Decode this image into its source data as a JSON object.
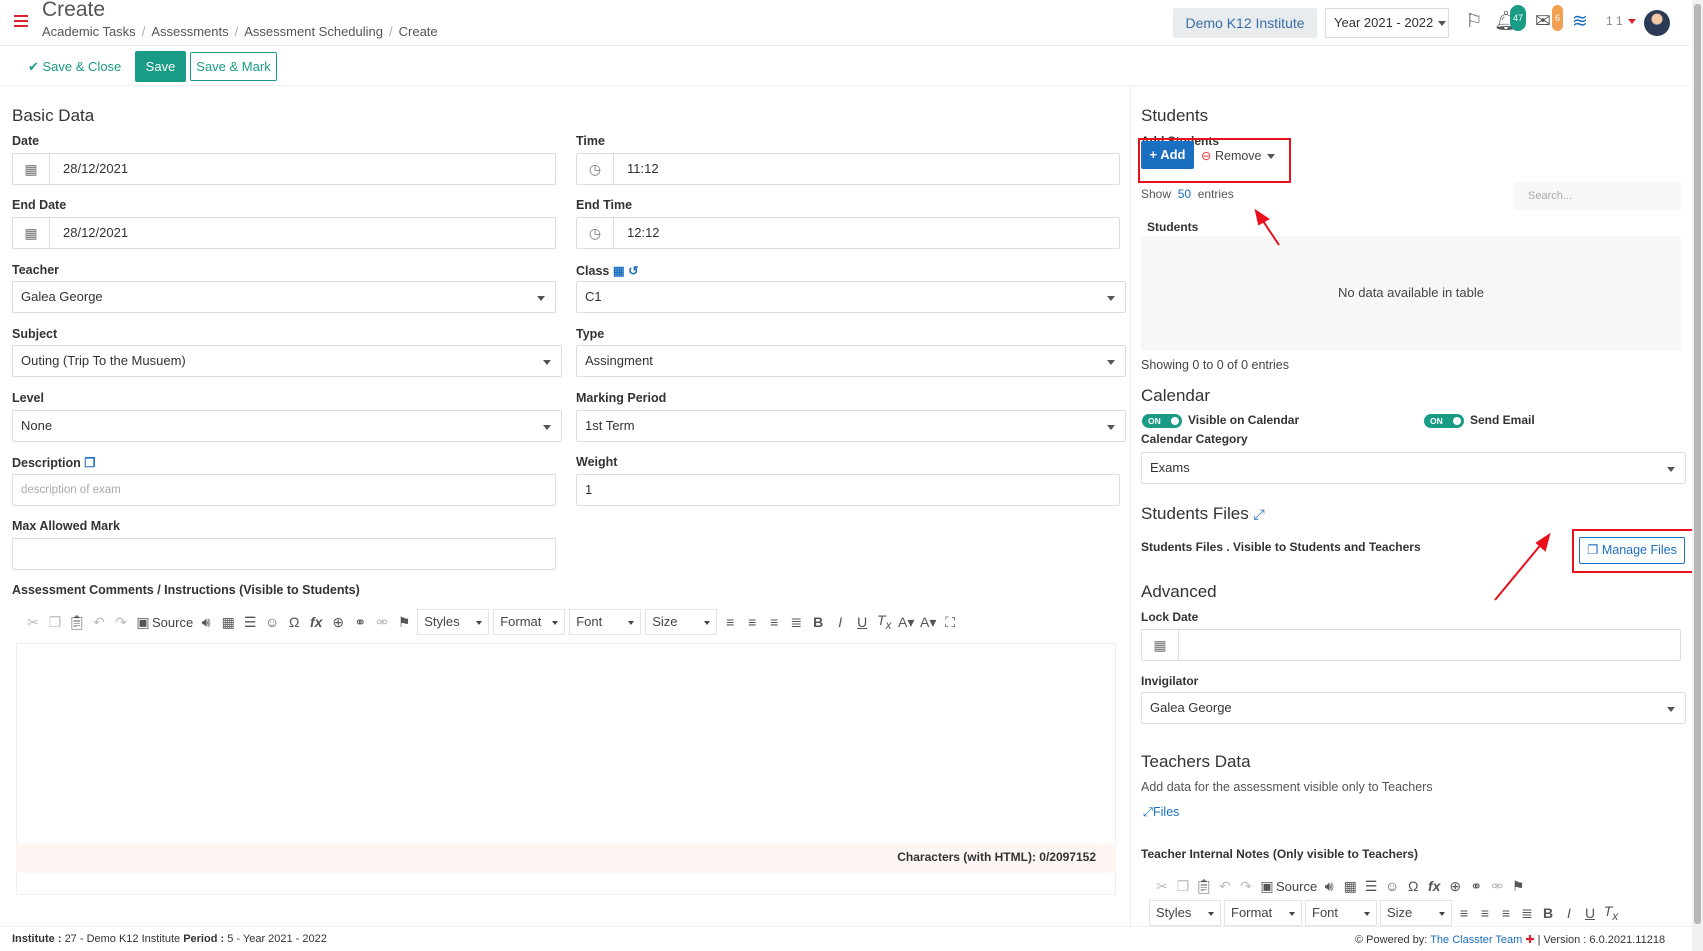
{
  "header": {
    "title": "Create",
    "breadcrumb": [
      "Academic Tasks",
      "Assessments",
      "Assessment Scheduling",
      "Create"
    ],
    "institute_button": "Demo K12 Institute",
    "year_select": "Year 2021 - 2022",
    "notif_count": "47",
    "mail_count": "6",
    "user_label": "1 1"
  },
  "actions": {
    "save_close": "Save & Close",
    "save": "Save",
    "save_mark": "Save & Mark"
  },
  "basic": {
    "heading": "Basic Data",
    "date_label": "Date",
    "date_value": "28/12/2021",
    "time_label": "Time",
    "time_value": "11:12",
    "end_date_label": "End Date",
    "end_date_value": "28/12/2021",
    "end_time_label": "End Time",
    "end_time_value": "12:12",
    "teacher_label": "Teacher",
    "teacher_value": "Galea George",
    "class_label": "Class",
    "class_value": "C1",
    "subject_label": "Subject",
    "subject_value": "Outing (Trip To the Musuem)",
    "type_label": "Type",
    "type_value": "Assingment",
    "level_label": "Level",
    "level_value": "None",
    "marking_label": "Marking Period",
    "marking_value": "1st Term",
    "description_label": "Description",
    "description_placeholder": "description of exam",
    "weight_label": "Weight",
    "weight_value": "1",
    "max_mark_label": "Max Allowed Mark",
    "comments_label": "Assessment Comments / Instructions (Visible to Students)",
    "char_count": "Characters (with HTML): 0/2097152"
  },
  "editor_toolbar": {
    "source": "Source",
    "styles": "Styles",
    "format": "Format",
    "font": "Font",
    "size": "Size"
  },
  "students": {
    "heading": "Students",
    "add_label": "Add Students",
    "add_button": "+ Add",
    "remove_button": "Remove",
    "show_label": "Show",
    "show_count": "50",
    "entries_label": "entries",
    "search_placeholder": "Search...",
    "column_header": "Students",
    "empty_text": "No data available in table",
    "showing_text": "Showing 0 to 0 of 0 entries"
  },
  "calendar": {
    "heading": "Calendar",
    "visible_label": "Visible on Calendar",
    "send_email_label": "Send Email",
    "toggle_on": "ON",
    "category_label": "Calendar Category",
    "category_value": "Exams"
  },
  "files": {
    "heading": "Students Files",
    "desc": "Students Files . Visible to Students and Teachers",
    "manage_button": "Manage Files"
  },
  "advanced": {
    "heading": "Advanced",
    "lock_label": "Lock Date",
    "invigilator_label": "Invigilator",
    "invigilator_value": "Galea George"
  },
  "teachers": {
    "heading": "Teachers Data",
    "desc": "Add data for the assessment visible only to Teachers",
    "files_link": "Files",
    "notes_label": "Teacher Internal Notes (Only visible to Teachers)"
  },
  "footer": {
    "institute_key": "Institute :",
    "institute_val": "27 - Demo K12 Institute",
    "period_key": "Period :",
    "period_val": "5 - Year 2021 - 2022",
    "powered_by": "Powered by:",
    "team": "The Classter Team",
    "version": "| Version : 6.0.2021.11218"
  },
  "colors": {
    "accent": "#1a9b85",
    "primary": "#1b6fc1",
    "annotation": "#e8101b"
  }
}
